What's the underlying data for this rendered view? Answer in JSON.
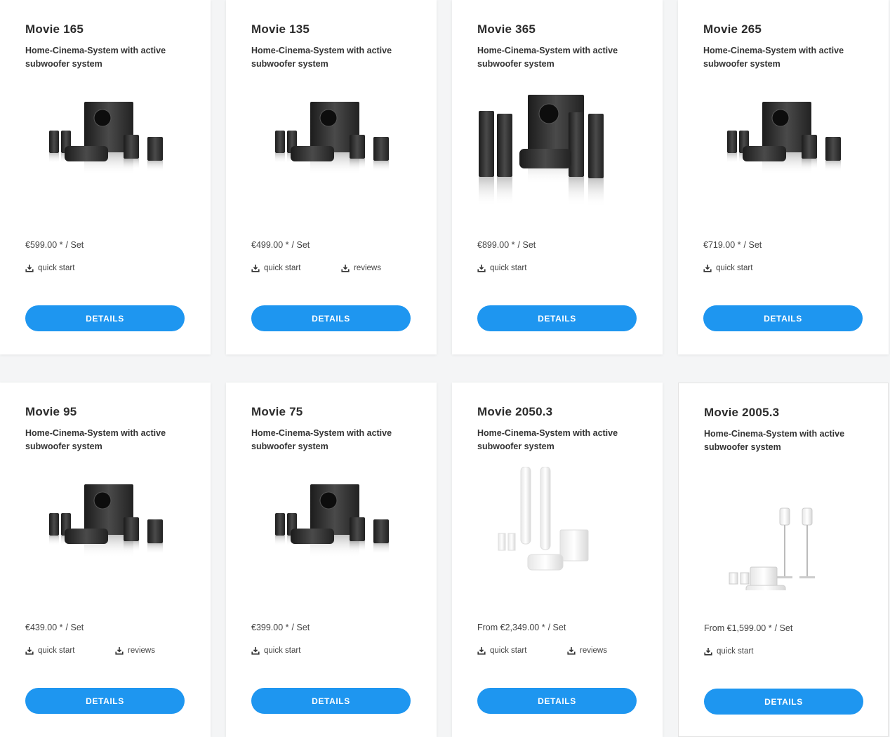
{
  "colors": {
    "accent": "#1e96f0",
    "card_background": "#ffffff",
    "text_primary": "#2b2b2b"
  },
  "products": [
    {
      "title": "Movie 165",
      "subtitle": "Home-Cinema-System with active subwoofer system",
      "price": "€599.00 *",
      "unit": "/ Set",
      "links": [
        {
          "label": "quick start",
          "icon": "download-icon"
        }
      ],
      "button": "DETAILS",
      "image_style": "black"
    },
    {
      "title": "Movie 135",
      "subtitle": "Home-Cinema-System with active subwoofer system",
      "price": "€499.00 *",
      "unit": "/ Set",
      "links": [
        {
          "label": "quick start",
          "icon": "download-icon"
        },
        {
          "label": "reviews",
          "icon": "download-icon"
        }
      ],
      "button": "DETAILS",
      "image_style": "black"
    },
    {
      "title": "Movie 365",
      "subtitle": "Home-Cinema-System with active subwoofer system",
      "price": "€899.00 *",
      "unit": "/ Set",
      "links": [
        {
          "label": "quick start",
          "icon": "download-icon"
        }
      ],
      "button": "DETAILS",
      "image_style": "black-tall"
    },
    {
      "title": "Movie 265",
      "subtitle": "Home-Cinema-System with active subwoofer system",
      "price": "€719.00 *",
      "unit": "/ Set",
      "links": [
        {
          "label": "quick start",
          "icon": "download-icon"
        }
      ],
      "button": "DETAILS",
      "image_style": "black"
    },
    {
      "title": "Movie 95",
      "subtitle": "Home-Cinema-System with active subwoofer system",
      "price": "€439.00 *",
      "unit": "/ Set",
      "links": [
        {
          "label": "quick start",
          "icon": "download-icon"
        },
        {
          "label": "reviews",
          "icon": "download-icon"
        }
      ],
      "button": "DETAILS",
      "image_style": "black"
    },
    {
      "title": "Movie 75",
      "subtitle": "Home-Cinema-System with active subwoofer system",
      "price": "€399.00 *",
      "unit": "/ Set",
      "links": [
        {
          "label": "quick start",
          "icon": "download-icon"
        }
      ],
      "button": "DETAILS",
      "image_style": "black"
    },
    {
      "title": "Movie 2050.3",
      "subtitle": "Home-Cinema-System with active subwoofer system",
      "price": "From €2,349.00 *",
      "unit": "/ Set",
      "links": [
        {
          "label": "quick start",
          "icon": "download-icon"
        },
        {
          "label": "reviews",
          "icon": "download-icon"
        }
      ],
      "button": "DETAILS",
      "image_style": "white-towers"
    },
    {
      "title": "Movie 2005.3",
      "subtitle": "Home-Cinema-System with active subwoofer system",
      "price": "From €1,599.00 *",
      "unit": "/ Set",
      "links": [
        {
          "label": "quick start",
          "icon": "download-icon"
        }
      ],
      "button": "DETAILS",
      "image_style": "white-stands"
    }
  ]
}
